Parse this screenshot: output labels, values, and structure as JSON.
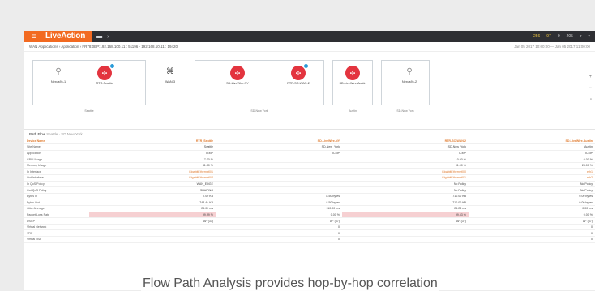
{
  "topbar": {
    "menu_icon": "hamburger-icon",
    "brand": "LiveAction",
    "right_items": [
      "256",
      "97",
      "0",
      "205",
      "▾",
      "▾"
    ]
  },
  "breadcrumb": {
    "path": "WAN Applications  ›  Application  ›  FR78:0BP:192.168.100.11 : 51196 - 192.168.10.11 : 19420",
    "time_range": "Jan 05 2017 10:00:00 — Jan 05 2017 11:00:00"
  },
  "topology": {
    "nodes": [
      {
        "label": "Nexus9k-1",
        "kind": "pc"
      },
      {
        "label": "RTR-Seattle",
        "kind": "router"
      },
      {
        "label": "WAN-3",
        "kind": "switch"
      },
      {
        "label": "SD-LiveWire-NY",
        "kind": "router"
      },
      {
        "label": "RTR-SC-WAN-2",
        "kind": "router"
      },
      {
        "label": "SD-LiveWire-Austin",
        "kind": "router"
      },
      {
        "label": "Nexus9k-2",
        "kind": "pc"
      }
    ],
    "groups": [
      "Seattle",
      "SD-New York",
      "Austin",
      "SD-New York"
    ]
  },
  "pathflow": {
    "title": "Path Flow",
    "subtitle": "Seattle · SD New York",
    "columns": [
      "RTR_Seattle",
      "SD-LiveWire-NY",
      "RTR-SC-WAN-2",
      "SD-LiveWire-Austin"
    ],
    "rows": [
      {
        "label": "Device Name",
        "values": [
          "RTR_Seattle",
          "SD-LiveWire-NY",
          "RTR-SC-WAN-2",
          "SD-LiveWire-Austin"
        ]
      },
      {
        "label": "Site Name",
        "values": [
          "Seattle",
          "SD-New_York",
          "SD-New_York",
          "Austin"
        ]
      },
      {
        "label": "Application",
        "values": [
          "ICMP",
          "ICMP",
          "ICMP",
          "ICMP"
        ]
      },
      {
        "label": "CPU Usage",
        "values": [
          "7.00 %",
          "",
          "0.00 %",
          "0.00 %"
        ]
      },
      {
        "label": "Memory Usage",
        "values": [
          "41.00 %",
          "",
          "91.00 %",
          "28.00 %"
        ]
      },
      {
        "label": "In Interface",
        "values": [
          "GigabitEthernet0/1",
          "",
          "GigabitEthernet0/0",
          "eth1"
        ]
      },
      {
        "label": "Out Interface",
        "values": [
          "GigabitEthernet0/2",
          "",
          "GigabitEthernet0/1",
          "eth2"
        ]
      },
      {
        "label": "In QoS Policy",
        "values": [
          "WAN_EDGE",
          "",
          "No Policy",
          "No Policy"
        ]
      },
      {
        "label": "Out QoS Policy",
        "values": [
          "SHAPING",
          "",
          "No Policy",
          "No Policy"
        ]
      },
      {
        "label": "Bytes In",
        "values": [
          "2.00 KB",
          "8.50 bytes",
          "710.00 KB",
          "0.00 bytes"
        ]
      },
      {
        "label": "Bytes Out",
        "values": "743.44 KB|8.50 bytes|710.00 KB|0.00 bytes",
        "note": ""
      },
      {
        "label": "Jitter Average",
        "values": [
          "25.00 ms",
          "110.00 ms",
          "25.28 ms",
          "0.00 ms"
        ]
      },
      {
        "label": "Packet Loss Rate",
        "values": [
          "99.99 %",
          "0.00 %",
          "99.53 %",
          "0.00 %"
        ]
      },
      {
        "label": "DSCP",
        "values": [
          "AF (37)",
          "AF (37)",
          "AF (37)",
          "AF (37)"
        ]
      },
      {
        "label": "Virtual Network",
        "values": [
          "",
          "0",
          "",
          "0"
        ]
      },
      {
        "label": "VRF",
        "values": [
          "",
          "0",
          "",
          "0"
        ]
      },
      {
        "label": "Virtual TBA",
        "values": [
          "",
          "0",
          "",
          "0"
        ]
      }
    ]
  },
  "caption": "Flow Path Analysis provides hop-by-hop correlation"
}
